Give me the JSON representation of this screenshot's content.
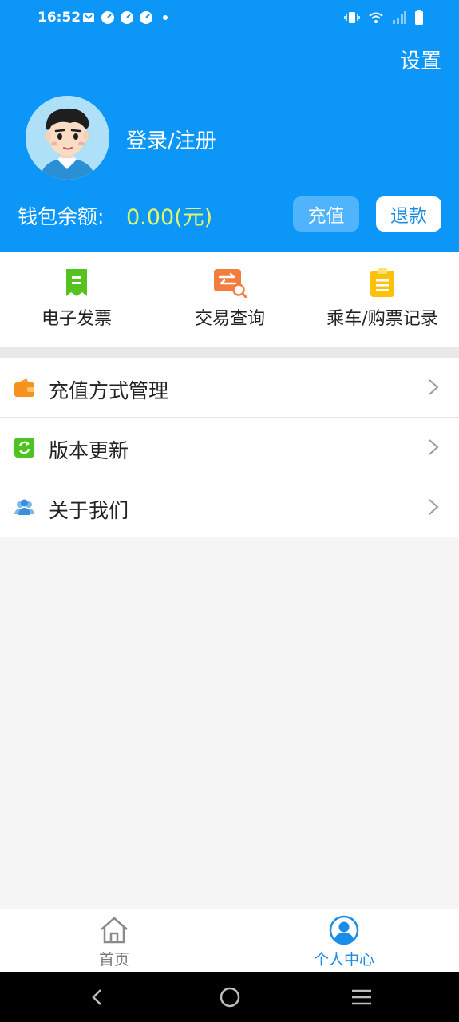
{
  "status": {
    "time": "16:52"
  },
  "header": {
    "settings_label": "设置",
    "login_label": "登录/注册",
    "balance_label": "钱包余额:",
    "balance_value": "0.00(元)",
    "recharge_label": "充值",
    "refund_label": "退款"
  },
  "quick_entries": [
    {
      "label": "电子发票",
      "icon": "invoice-icon"
    },
    {
      "label": "交易查询",
      "icon": "transaction-search-icon"
    },
    {
      "label": "乘车/购票记录",
      "icon": "clipboard-icon"
    }
  ],
  "menu": [
    {
      "label": "充值方式管理",
      "icon": "wallet-icon"
    },
    {
      "label": "版本更新",
      "icon": "refresh-icon"
    },
    {
      "label": "关于我们",
      "icon": "people-icon"
    }
  ],
  "tabs": [
    {
      "label": "首页",
      "icon": "home-icon"
    },
    {
      "label": "个人中心",
      "icon": "person-icon"
    }
  ],
  "colors": {
    "primary": "#0c96f7",
    "balance": "#e5f56a",
    "active_tab": "#1a8ce6"
  }
}
